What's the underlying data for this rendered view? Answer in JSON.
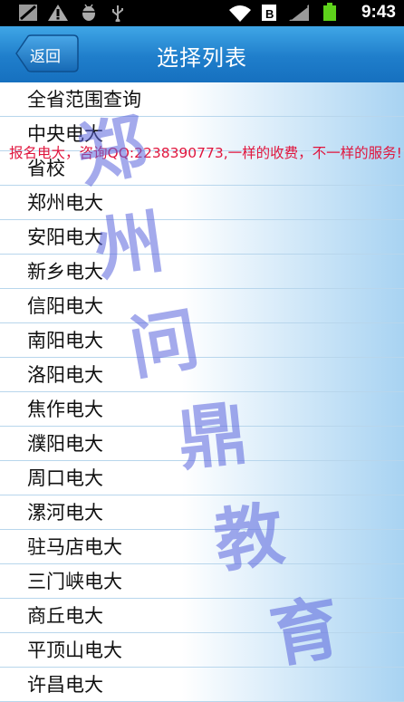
{
  "status_bar": {
    "time": "9:43",
    "left_icons": [
      "signal-off-icon",
      "warning-icon",
      "android-debug-icon",
      "usb-icon"
    ],
    "right_icons": [
      "wifi-icon",
      "notification-icon",
      "cell-signal-icon",
      "battery-icon"
    ]
  },
  "header": {
    "back_label": "返回",
    "title": "选择列表"
  },
  "list": {
    "items": [
      "全省范围查询",
      "中央电大",
      "省校",
      "郑州电大",
      "安阳电大",
      "新乡电大",
      "信阳电大",
      "南阳电大",
      "洛阳电大",
      "焦作电大",
      "濮阳电大",
      "周口电大",
      "漯河电大",
      "驻马店电大",
      "三门峡电大",
      "商丘电大",
      "平顶山电大",
      "许昌电大"
    ]
  },
  "overlay": {
    "banner_text": "报名电大，咨询QQ:2238390773,一样的收费，不一样的服务!",
    "watermark": [
      "郑",
      "州",
      "问",
      "鼎",
      "教",
      "育"
    ]
  },
  "colors": {
    "titlebar": "#1f7ecb",
    "banner": "#e0163e",
    "watermark": "#5a64dc"
  }
}
